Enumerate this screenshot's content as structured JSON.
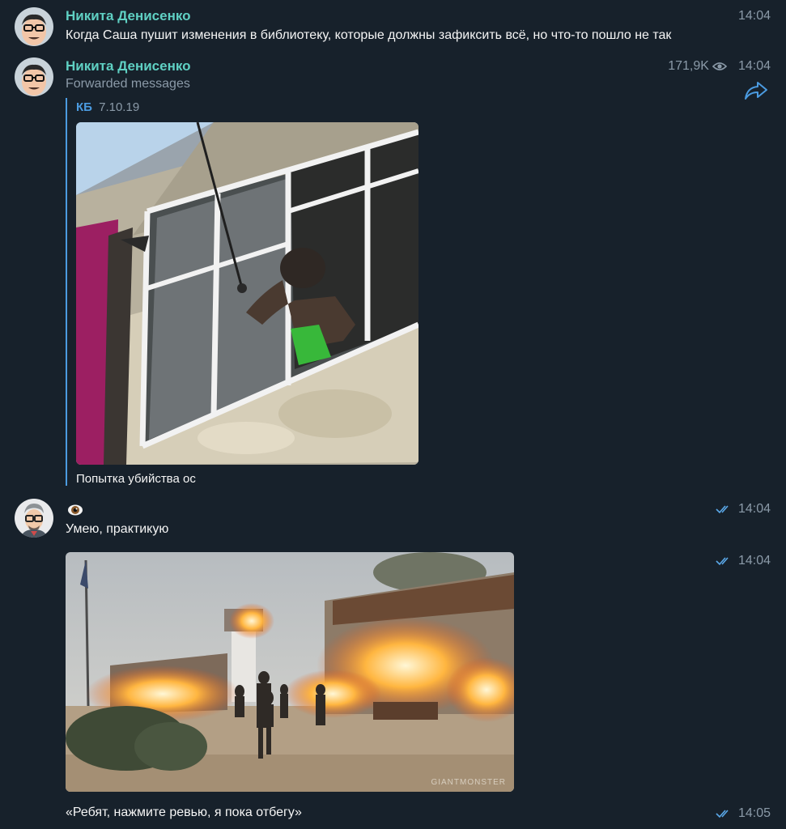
{
  "messages": [
    {
      "author": "Никита Денисенко",
      "text": "Когда Саша пушит изменения в библиотеку, которые должны зафиксить всё, но что-то пошло не так",
      "time": "14:04"
    },
    {
      "author": "Никита Денисенко",
      "subtitle": "Forwarded messages",
      "views": "171,9K",
      "time": "14:04",
      "forwarded": {
        "source": "КБ",
        "date": "7.10.19",
        "caption": "Попытка убийства ос"
      }
    },
    {
      "author_emoji": "👁",
      "text": "Умею, практикую",
      "time": "14:04"
    },
    {
      "time": "14:04",
      "watermark": "GIANTMONSTER"
    },
    {
      "text": "«Ребят, нажмите ревью, я пока отбегу»",
      "time": "14:05"
    }
  ],
  "icons": {
    "eye": "eye-icon",
    "share": "share-arrow-icon",
    "read": "double-check-icon"
  },
  "colors": {
    "background": "#17212b",
    "author_name": "#5fd0c3",
    "accent": "#4b9be0",
    "muted": "#8b9aa8"
  }
}
